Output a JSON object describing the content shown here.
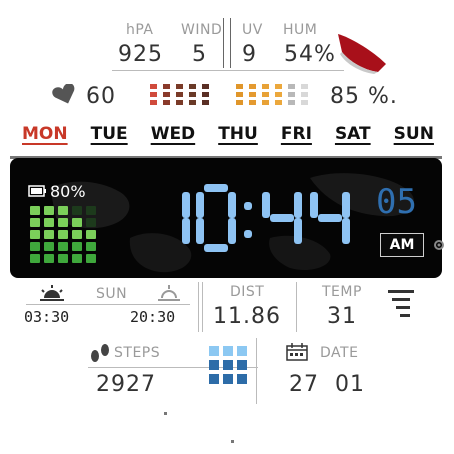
{
  "top": {
    "pressure_label": "hPA",
    "pressure_value": "925",
    "wind_label": "WIND",
    "wind_value": "5",
    "uv_label": "UV",
    "uv_value": "9",
    "humidity_label": "HUM",
    "humidity_value": "54%"
  },
  "status": {
    "heart_value": "60",
    "battery_percent_text": "85 %.",
    "heart_icon": "heart-icon"
  },
  "week": {
    "days": [
      "MON",
      "TUE",
      "WED",
      "THU",
      "FRI",
      "SAT",
      "SUN"
    ],
    "active_index": 0,
    "active_color": "#c83828"
  },
  "clock": {
    "hours": "10",
    "minutes": "44",
    "seconds": "05",
    "ampm": "AM",
    "watch_battery": "80%",
    "digit_color": "#8ec3f3",
    "seconds_color": "#2f6fb0"
  },
  "sun": {
    "label": "SUN",
    "sunrise": "03:30",
    "sunset": "20:30",
    "sunrise_icon": "sunrise-icon",
    "sunset_icon": "sunset-icon"
  },
  "distance": {
    "label": "DIST",
    "value": "11.86"
  },
  "temperature": {
    "label": "TEMP",
    "value": "31",
    "icon": "menu-lines-icon"
  },
  "steps": {
    "label": "STEPS",
    "value": "2927",
    "icon": "footprints-icon"
  },
  "date": {
    "label": "DATE",
    "day": "27",
    "month": "01",
    "icon": "calendar-icon"
  }
}
